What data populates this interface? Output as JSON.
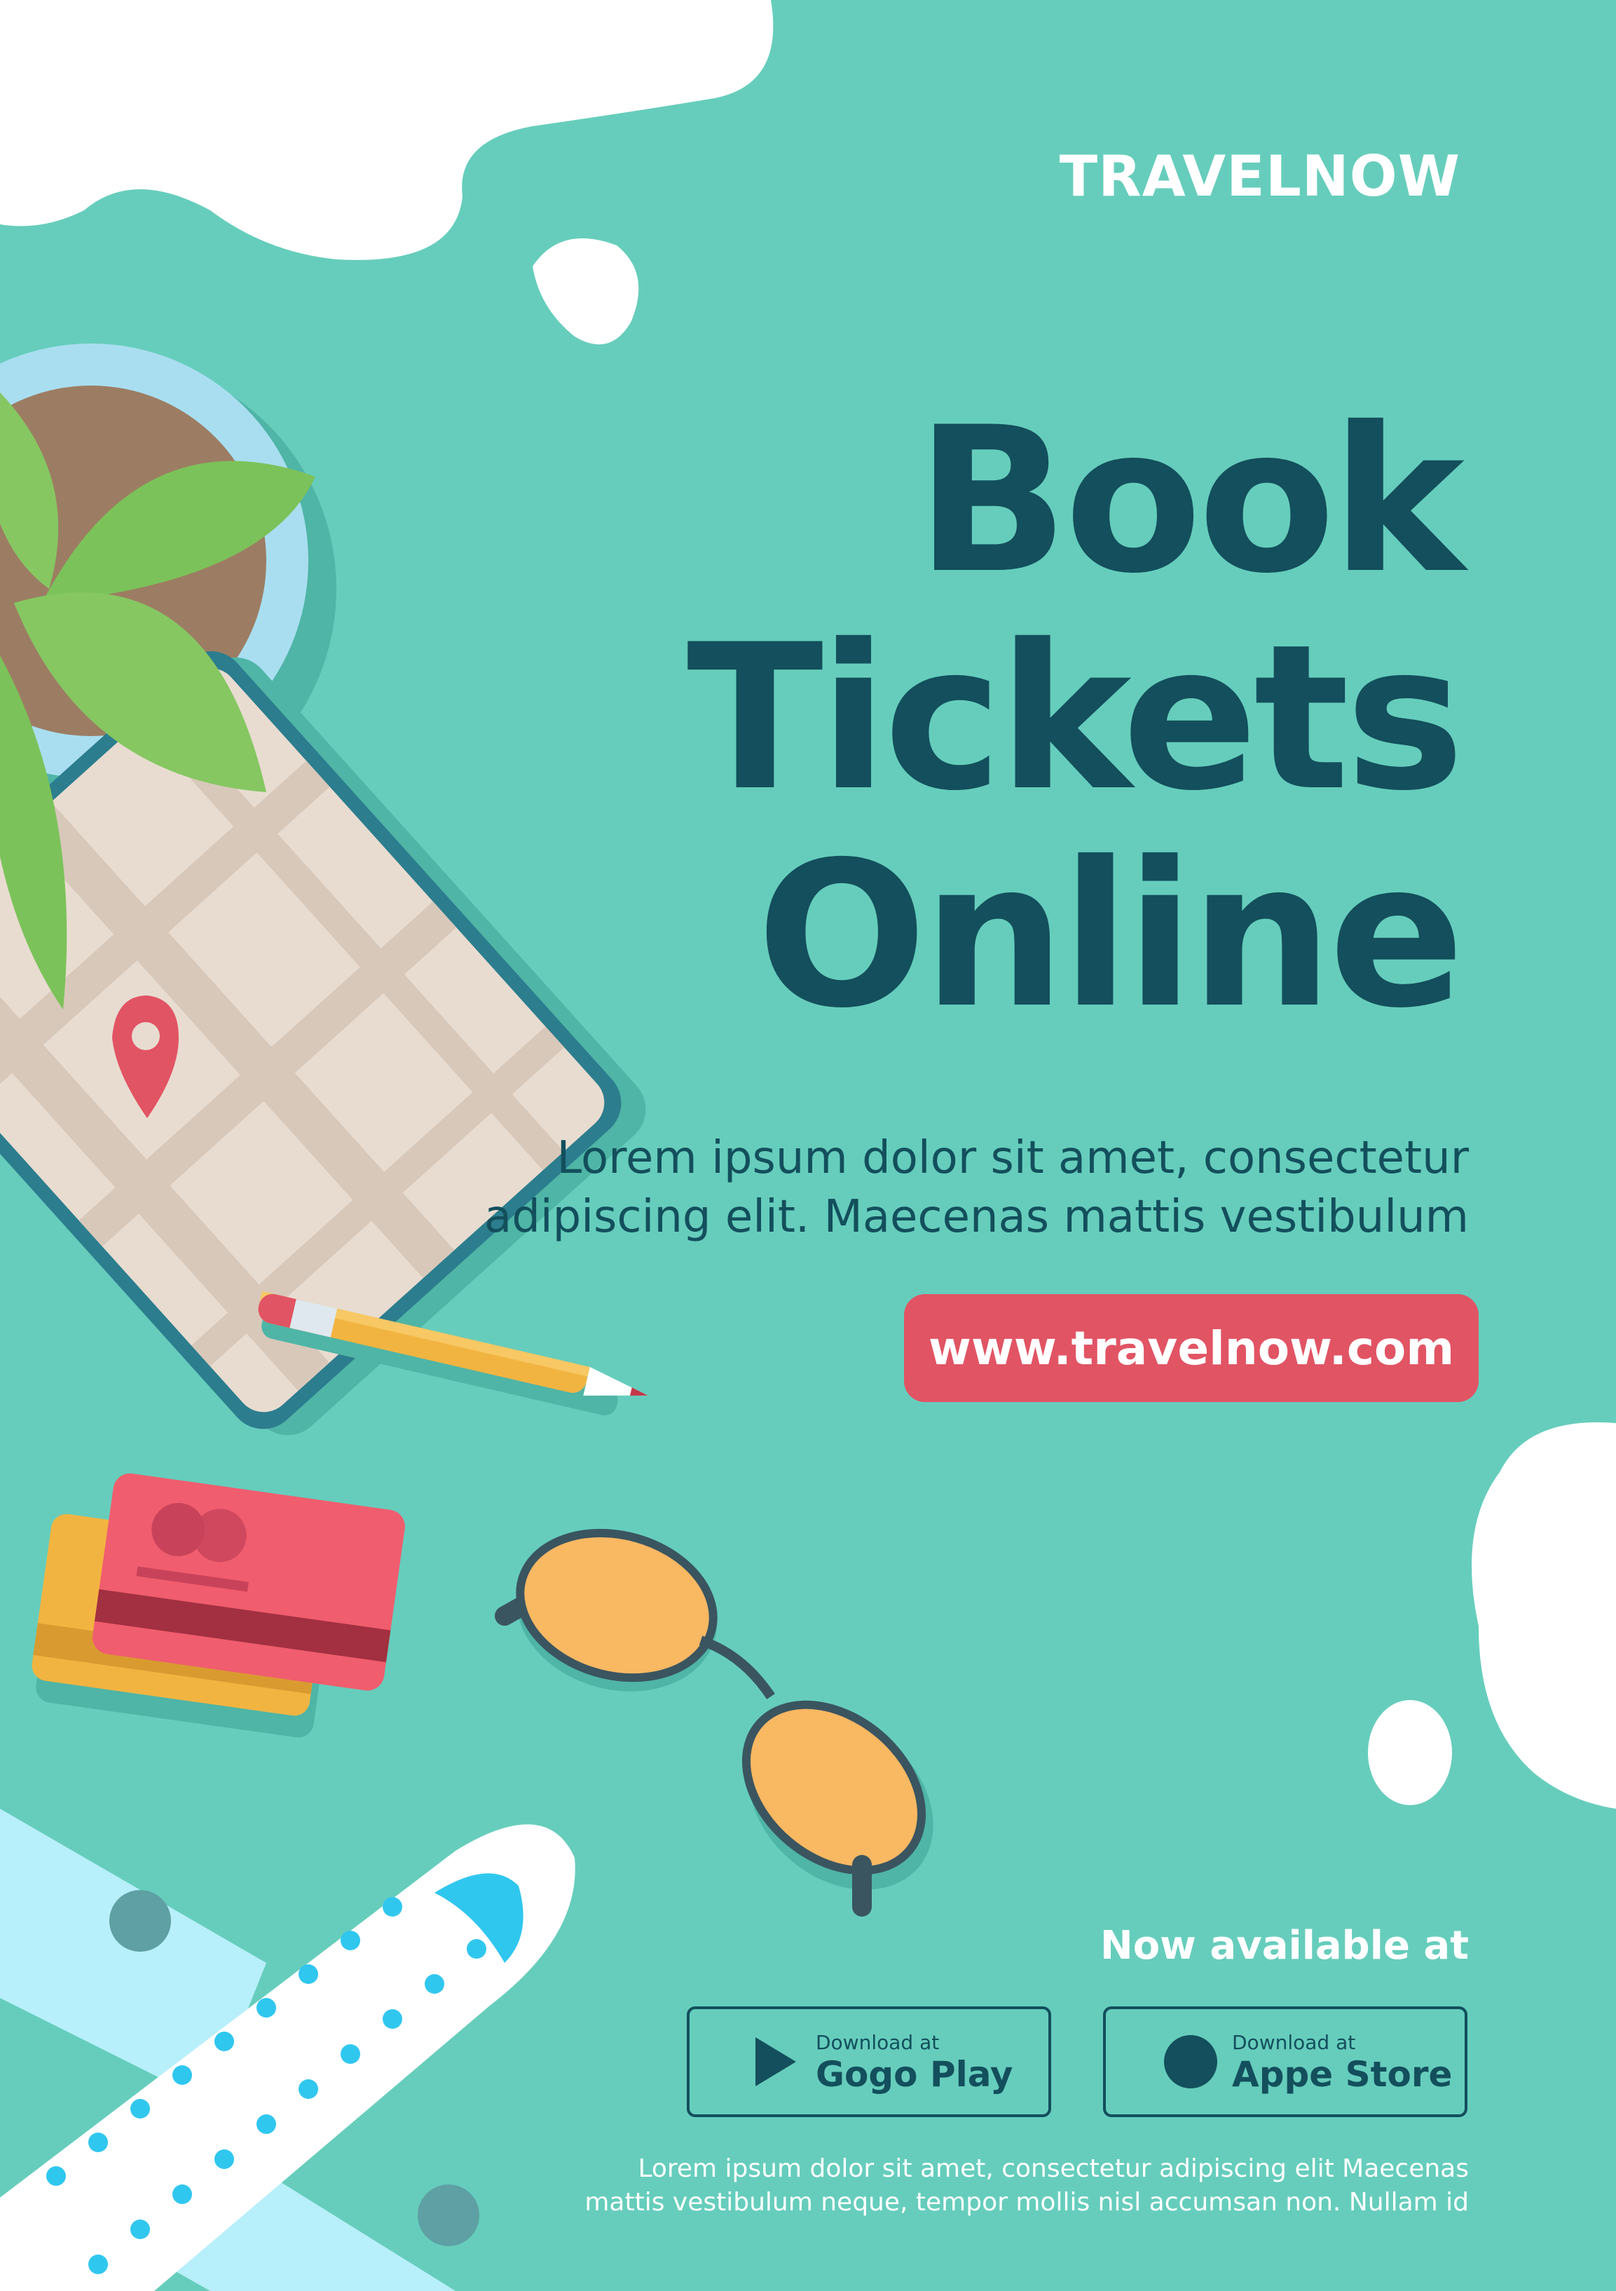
{
  "brand": {
    "name": "TRAVELNOW"
  },
  "headline": {
    "line1": "Book",
    "line2": "Tickets",
    "line3": "Online"
  },
  "body": {
    "line1": "Lorem ipsum dolor sit amet, consectetur",
    "line2": "adipiscing elit. Maecenas mattis vestibulum"
  },
  "cta": {
    "url_label": "www.travelnow.com"
  },
  "availability": {
    "label": "Now available at"
  },
  "stores": {
    "google": {
      "small": "Download at",
      "big": "Gogo Play",
      "icon": "play-icon"
    },
    "apple": {
      "small": "Download at",
      "big": "Appe Store",
      "icon": "circle-icon"
    }
  },
  "footer": {
    "line1": "Lorem ipsum dolor sit amet, consectetur adipiscing elit Maecenas",
    "line2": "mattis vestibulum neque, tempor mollis nisl accumsan non. Nullam id"
  },
  "colors": {
    "background": "#66cdbc",
    "headline": "#134f5c",
    "accent": "#e15464",
    "white": "#ffffff"
  }
}
